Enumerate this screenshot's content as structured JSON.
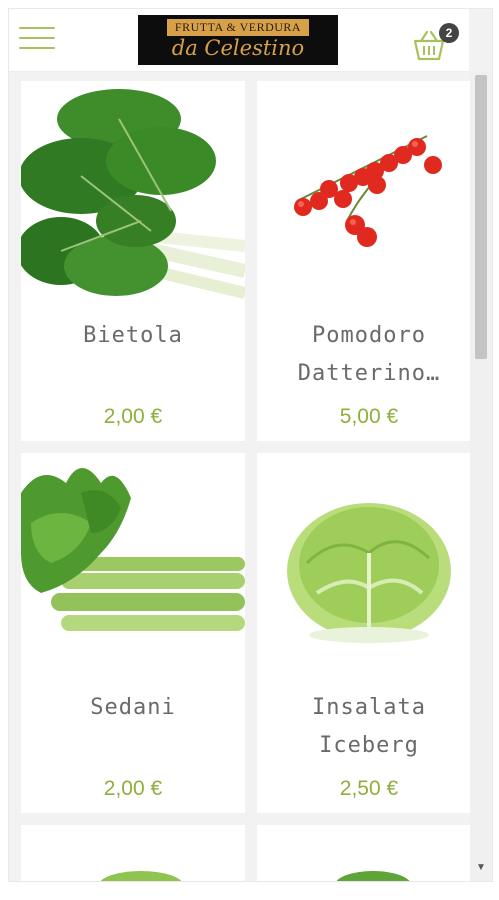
{
  "header": {
    "logo_top": "FRUTTA & VERDURA",
    "logo_bottom": "da Celestino",
    "cart_count": "2"
  },
  "products": [
    {
      "name_line1": "Bietola",
      "name_line2": "",
      "price": "2,00 €"
    },
    {
      "name_line1": "Pomodoro",
      "name_line2": "Datterino…",
      "price": "5,00 €"
    },
    {
      "name_line1": "Sedani",
      "name_line2": "",
      "price": "2,00 €"
    },
    {
      "name_line1": "Insalata",
      "name_line2": "Iceberg",
      "price": "2,50 €"
    }
  ],
  "colors": {
    "accent_green": "#8fae3c",
    "logo_gold": "#d7a14a",
    "menu_icon": "#a7c25b"
  },
  "icons": {
    "menu": "hamburger-menu-icon",
    "cart": "shopping-basket-icon"
  }
}
